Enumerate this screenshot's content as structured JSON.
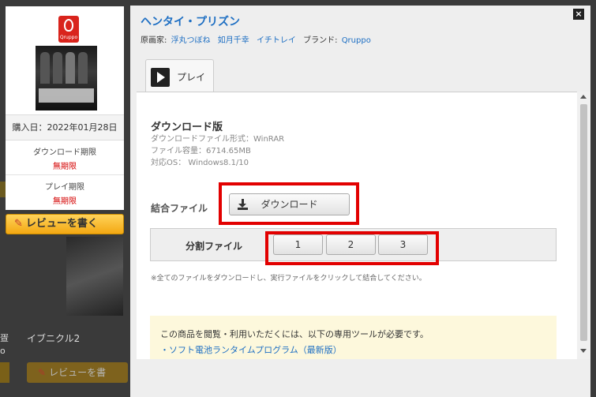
{
  "background": {
    "purchase_date": "購入日：2022年01月28日",
    "download_limit_label": "ダウンロード期限",
    "download_limit_value": "無期限",
    "play_limit_label": "プレイ期限",
    "play_limit_value": "無期限",
    "review_label": "レビューを書く",
    "logo_text": "Qruppo",
    "next_item_title": "イブニクル2",
    "partial_text_1": "疍",
    "partial_text_2": "o",
    "review_label_2": "レビューを書"
  },
  "modal": {
    "title": "ヘンタイ・プリズン",
    "illustrator_label": "原画家:",
    "illustrators": [
      "浮丸つぼね",
      "如月千幸",
      "イチトレイ"
    ],
    "brand_label": "ブランド:",
    "brand": "Qruppo",
    "close_label": "×",
    "tab_label": "プレイ",
    "download_title": "ダウンロード版",
    "info": {
      "format": "ダウンロードファイル形式：WinRAR",
      "size": "ファイル容量：6714.65MB",
      "os": "対応OS： Windows8.1/10"
    },
    "combined_label": "結合ファイル",
    "download_button": "ダウンロード",
    "split_label": "分割ファイル",
    "split_buttons": [
      "1",
      "2",
      "3"
    ],
    "note": "※全てのファイルをダウンロードし、実行ファイルをクリックして結合してください。",
    "tool_text": "この商品を閲覧・利用いただくには、以下の専用ツールが必要です。",
    "tool_link": "・ソフト電池ランタイムプログラム（最新版）"
  }
}
